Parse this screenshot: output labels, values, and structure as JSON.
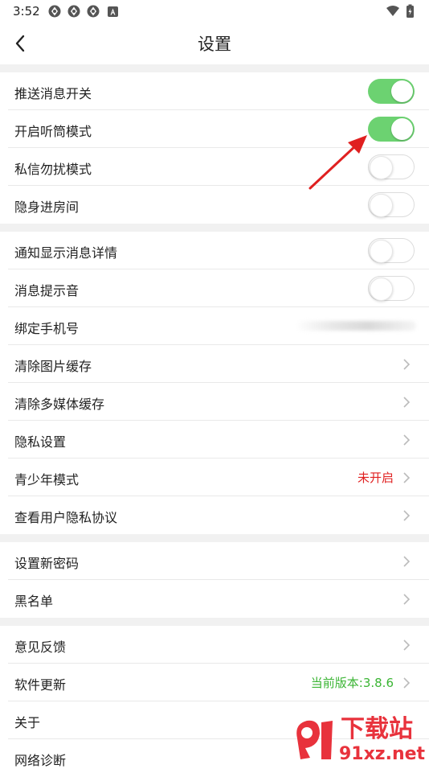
{
  "status_bar": {
    "time": "3:52"
  },
  "header": {
    "title": "设置"
  },
  "section1": [
    {
      "label": "推送消息开关",
      "toggle": "on"
    },
    {
      "label": "开启听筒模式",
      "toggle": "on"
    },
    {
      "label": "私信勿扰模式",
      "toggle": "off"
    },
    {
      "label": "隐身进房间",
      "toggle": "off"
    }
  ],
  "section2": {
    "notify_detail": {
      "label": "通知显示消息详情",
      "toggle": "off"
    },
    "notify_sound": {
      "label": "消息提示音",
      "toggle": "off"
    },
    "bind_phone": {
      "label": "绑定手机号"
    },
    "clear_image_cache": {
      "label": "清除图片缓存"
    },
    "clear_media_cache": {
      "label": "清除多媒体缓存"
    },
    "privacy_settings": {
      "label": "隐私设置"
    },
    "youth_mode": {
      "label": "青少年模式",
      "value": "未开启",
      "value_color": "#e02020"
    },
    "privacy_policy": {
      "label": "查看用户隐私协议"
    }
  },
  "section3": {
    "new_password": {
      "label": "设置新密码"
    },
    "blacklist": {
      "label": "黑名单"
    }
  },
  "section4": {
    "feedback": {
      "label": "意见反馈"
    },
    "update": {
      "label": "软件更新",
      "value": "当前版本:3.8.6",
      "value_color": "#3bb534"
    },
    "about": {
      "label": "关于"
    },
    "network": {
      "label": "网络诊断"
    }
  },
  "colors": {
    "toggle_on": "#6cd271",
    "section_gap": "#f1f1f1",
    "annotation_arrow": "#e02020"
  },
  "watermark": {
    "text": "下载站",
    "url": "91xz.net"
  }
}
